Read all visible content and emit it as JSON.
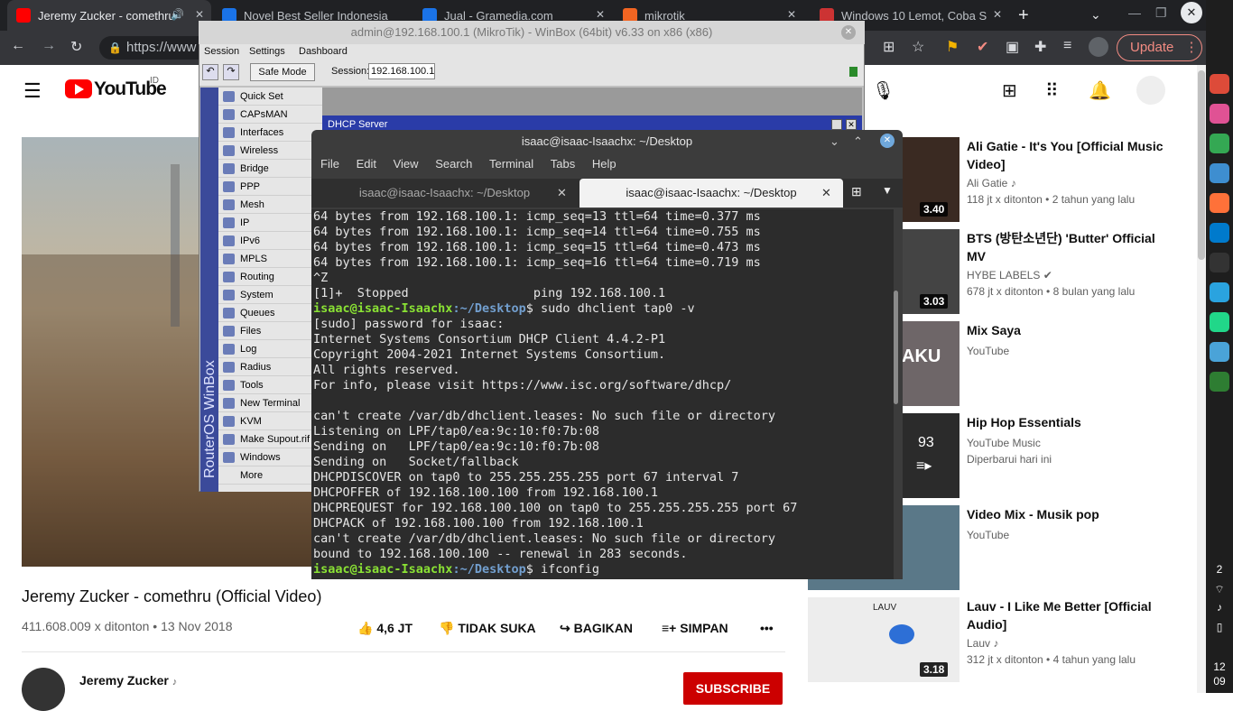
{
  "browser": {
    "tabs": [
      {
        "title": "Jeremy Zucker - comethru",
        "favicon_color": "#ff0000"
      },
      {
        "title": "Novel Best Seller Indonesia",
        "favicon_color": "#1a73e8"
      },
      {
        "title": "Jual - Gramedia.com",
        "favicon_color": "#1a73e8"
      },
      {
        "title": "mikrotik",
        "favicon_color": "#f26522"
      },
      {
        "title": "Windows 10 Lemot, Coba S",
        "favicon_color": "#cc3333"
      }
    ],
    "url": "https://www",
    "update_label": "Update"
  },
  "youtube": {
    "logo_text": "YouTube",
    "country": "ID",
    "video_title": "Jeremy Zucker - comethru (Official Video)",
    "views_date": "411.608.009 x ditonton • 13 Nov 2018",
    "like_label": "4,6 JT",
    "dislike_label": "TIDAK SUKA",
    "share_label": "BAGIKAN",
    "save_label": "SIMPAN",
    "more_label": "•••",
    "channel_name": "Jeremy Zucker",
    "subscribe_label": "SUBSCRIBE",
    "recommendations": [
      {
        "title": "Ali Gatie - It's You [Official Music Video]",
        "channel": "Ali Gatie",
        "meta": "118 jt x ditonton • 2 tahun yang lalu",
        "duration": "3.40",
        "thumb_color": "#3a2a22"
      },
      {
        "title": "BTS (방탄소년단) 'Butter' Official MV",
        "channel": "HYBE LABELS",
        "meta": "678 jt x ditonton • 8 bulan yang lalu",
        "duration": "3.03",
        "thumb_color": "#444444"
      },
      {
        "title": "Mix Saya",
        "channel": "YouTube",
        "meta": "",
        "duration": "",
        "thumb_color": "#6e6668",
        "overlay": "AKU"
      },
      {
        "title": "Hip Hop Essentials",
        "channel": "YouTube Music",
        "meta": "Diperbarui hari ini",
        "duration": "",
        "thumb_color": "#2b2b2b",
        "overlay": "93"
      },
      {
        "title": "Video Mix - Musik pop",
        "channel": "YouTube",
        "meta": "",
        "duration": "",
        "thumb_color": "#5a7888"
      },
      {
        "title": "Lauv - I Like Me Better [Official Audio]",
        "channel": "Lauv",
        "meta": "312 jt x ditonton • 4 tahun yang lalu",
        "duration": "3.18",
        "thumb_color": "#ededed",
        "overlay": "LAUV"
      }
    ]
  },
  "winbox": {
    "title": "admin@192.168.100.1 (MikroTik) - WinBox (64bit) v6.33 on x86 (x86)",
    "menu": [
      "Session",
      "Settings",
      "Dashboard"
    ],
    "safe_mode": "Safe Mode",
    "session_label": "Session:",
    "session_value": "192.168.100.1",
    "side_label": "RouterOS WinBox",
    "nav": [
      "Quick Set",
      "CAPsMAN",
      "Interfaces",
      "Wireless",
      "Bridge",
      "PPP",
      "Mesh",
      "IP",
      "IPv6",
      "MPLS",
      "Routing",
      "System",
      "Queues",
      "Files",
      "Log",
      "Radius",
      "Tools",
      "New Terminal",
      "KVM",
      "Make Supout.rif",
      "Windows",
      "More"
    ],
    "dhcp_window": "DHCP Server"
  },
  "terminal": {
    "title": "isaac@isaac-Isaachx: ~/Desktop",
    "menu": [
      "File",
      "Edit",
      "View",
      "Search",
      "Terminal",
      "Tabs",
      "Help"
    ],
    "tabs": [
      "isaac@isaac-Isaachx: ~/Desktop",
      "isaac@isaac-Isaachx: ~/Desktop"
    ],
    "lines": [
      {
        "t": "64 bytes from 192.168.100.1: icmp_seq=13 ttl=64 time=0.377 ms"
      },
      {
        "t": "64 bytes from 192.168.100.1: icmp_seq=14 ttl=64 time=0.755 ms"
      },
      {
        "t": "64 bytes from 192.168.100.1: icmp_seq=15 ttl=64 time=0.473 ms"
      },
      {
        "t": "64 bytes from 192.168.100.1: icmp_seq=16 ttl=64 time=0.719 ms"
      },
      {
        "t": "^Z"
      },
      {
        "t": "[1]+  Stopped                 ping 192.168.100.1"
      },
      {
        "u": "isaac@isaac-Isaachx",
        "p": ":~/Desktop",
        "t": "$ sudo dhclient tap0 -v"
      },
      {
        "t": "[sudo] password for isaac:"
      },
      {
        "t": "Internet Systems Consortium DHCP Client 4.4.2-P1"
      },
      {
        "t": "Copyright 2004-2021 Internet Systems Consortium."
      },
      {
        "t": "All rights reserved."
      },
      {
        "t": "For info, please visit https://www.isc.org/software/dhcp/"
      },
      {
        "t": ""
      },
      {
        "t": "can't create /var/db/dhclient.leases: No such file or directory"
      },
      {
        "t": "Listening on LPF/tap0/ea:9c:10:f0:7b:08"
      },
      {
        "t": "Sending on   LPF/tap0/ea:9c:10:f0:7b:08"
      },
      {
        "t": "Sending on   Socket/fallback"
      },
      {
        "t": "DHCPDISCOVER on tap0 to 255.255.255.255 port 67 interval 7"
      },
      {
        "t": "DHCPOFFER of 192.168.100.100 from 192.168.100.1"
      },
      {
        "t": "DHCPREQUEST for 192.168.100.100 on tap0 to 255.255.255.255 port 67"
      },
      {
        "t": "DHCPACK of 192.168.100.100 from 192.168.100.1"
      },
      {
        "t": "can't create /var/db/dhclient.leases: No such file or directory"
      },
      {
        "t": "bound to 192.168.100.100 -- renewal in 283 seconds."
      },
      {
        "u": "isaac@isaac-Isaachx",
        "p": ":~/Desktop",
        "t": "$ ifconfig"
      }
    ]
  },
  "dock": {
    "icons": [
      {
        "name": "chrome-icon",
        "color": "#dd4b39"
      },
      {
        "name": "flickr-icon",
        "color": "#e05294"
      },
      {
        "name": "maps-icon",
        "color": "#34a853"
      },
      {
        "name": "files-icon",
        "color": "#3e8ed0"
      },
      {
        "name": "firefox-icon",
        "color": "#ff7139"
      },
      {
        "name": "vscode-icon",
        "color": "#007acc"
      },
      {
        "name": "terminal-icon",
        "color": "#333333"
      },
      {
        "name": "telegram-icon",
        "color": "#2aa3df"
      },
      {
        "name": "pycharm-icon",
        "color": "#21d789"
      },
      {
        "name": "monitor-icon",
        "color": "#4aa3d8"
      },
      {
        "name": "activity-icon",
        "color": "#2e7d32"
      }
    ],
    "status_count": "2",
    "clock_hour": "12",
    "clock_minute": "09"
  }
}
